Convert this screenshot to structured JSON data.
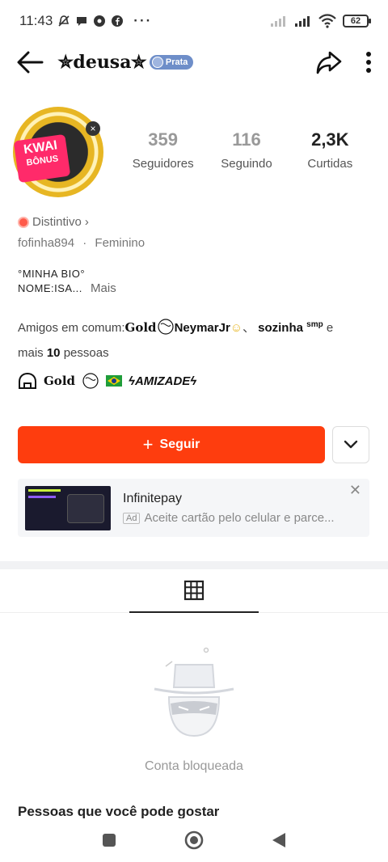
{
  "status_bar": {
    "time": "11:43",
    "battery": "62"
  },
  "header": {
    "title": "✮deusa✮",
    "badge": "Prata"
  },
  "avatar": {
    "badge_line1": "KWAI",
    "badge_line2": "BÔNUS"
  },
  "stats": [
    {
      "value": "359",
      "label": "Seguidores"
    },
    {
      "value": "116",
      "label": "Seguindo"
    },
    {
      "value": "2,3K",
      "label": "Curtidas"
    }
  ],
  "profile": {
    "distintivo": "Distintivo",
    "username": "fofinha894",
    "separator": "·",
    "gender": "Feminino",
    "bio_line1": "°MINHA BIO°",
    "bio_line2": "NOME:ISA...",
    "more": "Mais"
  },
  "mutual": {
    "prefix": "Amigos em comum:",
    "friend1": "Gold",
    "friend2": "NeymarJr",
    "separator": "、",
    "friend3": "sozinha",
    "friend3_suffix": "smp",
    "suffix_before": "e",
    "suffix_mais": "mais",
    "count": "10",
    "suffix_after": "pessoas"
  },
  "group": {
    "name": "Gold",
    "tag": "ϟAMIZADEϟ"
  },
  "actions": {
    "follow": "Seguir"
  },
  "ad": {
    "title": "Infinitepay",
    "tag": "Ad",
    "description": "Aceite cartão pelo celular e parce..."
  },
  "content": {
    "blocked": "Conta bloqueada",
    "suggestions": "Pessoas que você pode gostar"
  },
  "colors": {
    "follow": "#fe3d0e",
    "badge": "#6e8ec9"
  }
}
